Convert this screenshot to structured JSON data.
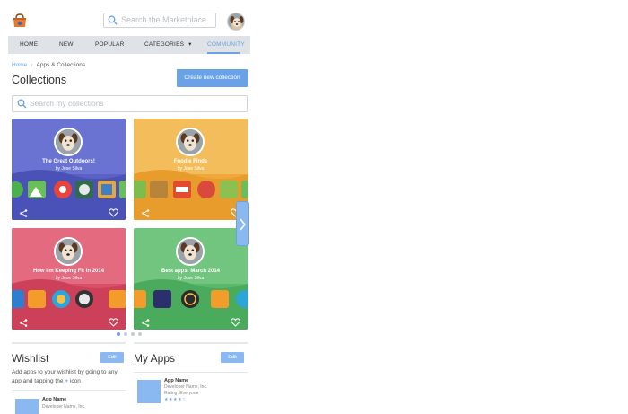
{
  "topbar": {
    "search_placeholder": "Search the Marketplace"
  },
  "nav": {
    "items": [
      {
        "label": "HOME"
      },
      {
        "label": "NEW"
      },
      {
        "label": "POPULAR"
      },
      {
        "label": "CATEGORIES"
      },
      {
        "label": "COMMUNITY",
        "active": true
      }
    ],
    "categories_caret": "▾"
  },
  "breadcrumb": {
    "home": "Home",
    "current": "Apps & Collections"
  },
  "page_title": "Collections",
  "create_button": "Create new collection",
  "collection_search_placeholder": "Search my collections",
  "collections": [
    {
      "title": "The Great Outdoors!",
      "author": "by Jose Silva",
      "color": "#5b63c7"
    },
    {
      "title": "Foodie Finds",
      "author": "by Jose Silva",
      "color": "#f0b23e"
    },
    {
      "title": "How I'm Keeping Fit in 2014",
      "author": "by Jose Silva",
      "color": "#d9556a"
    },
    {
      "title": "Best apps: March 2014",
      "author": "by Jose Silva",
      "color": "#5ebd6f"
    }
  ],
  "carousel": {
    "pages": 4,
    "current": 1
  },
  "wishlist": {
    "title": "Wishlist",
    "edit_label": "Edit",
    "hint_before": "Add apps to your wishlist by going to any app and tapping the",
    "hint_plus": "+",
    "hint_after": "icon",
    "app": {
      "name": "App Name",
      "developer": "Developer Name, Inc."
    }
  },
  "my_apps": {
    "title": "My Apps",
    "edit_label": "Edit",
    "app": {
      "name": "App Name",
      "developer": "Developer Name, Inc.",
      "rating_text": "Rating: Everyone",
      "stars": "★★★★☆"
    }
  },
  "colors": {
    "accent": "#6aa2e8",
    "nav_bg": "#dfe2e6"
  }
}
